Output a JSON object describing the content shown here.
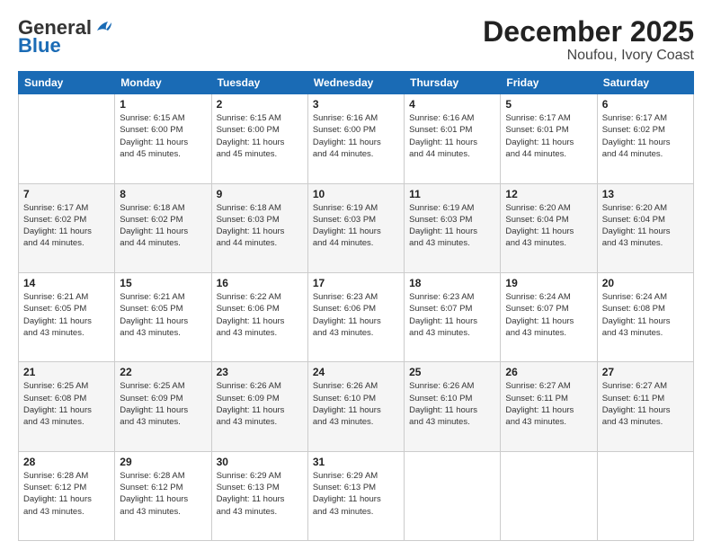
{
  "header": {
    "logo_general": "General",
    "logo_blue": "Blue",
    "title": "December 2025",
    "subtitle": "Noufou, Ivory Coast"
  },
  "weekdays": [
    "Sunday",
    "Monday",
    "Tuesday",
    "Wednesday",
    "Thursday",
    "Friday",
    "Saturday"
  ],
  "weeks": [
    [
      {
        "num": "",
        "info": ""
      },
      {
        "num": "1",
        "info": "Sunrise: 6:15 AM\nSunset: 6:00 PM\nDaylight: 11 hours\nand 45 minutes."
      },
      {
        "num": "2",
        "info": "Sunrise: 6:15 AM\nSunset: 6:00 PM\nDaylight: 11 hours\nand 45 minutes."
      },
      {
        "num": "3",
        "info": "Sunrise: 6:16 AM\nSunset: 6:00 PM\nDaylight: 11 hours\nand 44 minutes."
      },
      {
        "num": "4",
        "info": "Sunrise: 6:16 AM\nSunset: 6:01 PM\nDaylight: 11 hours\nand 44 minutes."
      },
      {
        "num": "5",
        "info": "Sunrise: 6:17 AM\nSunset: 6:01 PM\nDaylight: 11 hours\nand 44 minutes."
      },
      {
        "num": "6",
        "info": "Sunrise: 6:17 AM\nSunset: 6:02 PM\nDaylight: 11 hours\nand 44 minutes."
      }
    ],
    [
      {
        "num": "7",
        "info": "Sunrise: 6:17 AM\nSunset: 6:02 PM\nDaylight: 11 hours\nand 44 minutes."
      },
      {
        "num": "8",
        "info": "Sunrise: 6:18 AM\nSunset: 6:02 PM\nDaylight: 11 hours\nand 44 minutes."
      },
      {
        "num": "9",
        "info": "Sunrise: 6:18 AM\nSunset: 6:03 PM\nDaylight: 11 hours\nand 44 minutes."
      },
      {
        "num": "10",
        "info": "Sunrise: 6:19 AM\nSunset: 6:03 PM\nDaylight: 11 hours\nand 44 minutes."
      },
      {
        "num": "11",
        "info": "Sunrise: 6:19 AM\nSunset: 6:03 PM\nDaylight: 11 hours\nand 43 minutes."
      },
      {
        "num": "12",
        "info": "Sunrise: 6:20 AM\nSunset: 6:04 PM\nDaylight: 11 hours\nand 43 minutes."
      },
      {
        "num": "13",
        "info": "Sunrise: 6:20 AM\nSunset: 6:04 PM\nDaylight: 11 hours\nand 43 minutes."
      }
    ],
    [
      {
        "num": "14",
        "info": "Sunrise: 6:21 AM\nSunset: 6:05 PM\nDaylight: 11 hours\nand 43 minutes."
      },
      {
        "num": "15",
        "info": "Sunrise: 6:21 AM\nSunset: 6:05 PM\nDaylight: 11 hours\nand 43 minutes."
      },
      {
        "num": "16",
        "info": "Sunrise: 6:22 AM\nSunset: 6:06 PM\nDaylight: 11 hours\nand 43 minutes."
      },
      {
        "num": "17",
        "info": "Sunrise: 6:23 AM\nSunset: 6:06 PM\nDaylight: 11 hours\nand 43 minutes."
      },
      {
        "num": "18",
        "info": "Sunrise: 6:23 AM\nSunset: 6:07 PM\nDaylight: 11 hours\nand 43 minutes."
      },
      {
        "num": "19",
        "info": "Sunrise: 6:24 AM\nSunset: 6:07 PM\nDaylight: 11 hours\nand 43 minutes."
      },
      {
        "num": "20",
        "info": "Sunrise: 6:24 AM\nSunset: 6:08 PM\nDaylight: 11 hours\nand 43 minutes."
      }
    ],
    [
      {
        "num": "21",
        "info": "Sunrise: 6:25 AM\nSunset: 6:08 PM\nDaylight: 11 hours\nand 43 minutes."
      },
      {
        "num": "22",
        "info": "Sunrise: 6:25 AM\nSunset: 6:09 PM\nDaylight: 11 hours\nand 43 minutes."
      },
      {
        "num": "23",
        "info": "Sunrise: 6:26 AM\nSunset: 6:09 PM\nDaylight: 11 hours\nand 43 minutes."
      },
      {
        "num": "24",
        "info": "Sunrise: 6:26 AM\nSunset: 6:10 PM\nDaylight: 11 hours\nand 43 minutes."
      },
      {
        "num": "25",
        "info": "Sunrise: 6:26 AM\nSunset: 6:10 PM\nDaylight: 11 hours\nand 43 minutes."
      },
      {
        "num": "26",
        "info": "Sunrise: 6:27 AM\nSunset: 6:11 PM\nDaylight: 11 hours\nand 43 minutes."
      },
      {
        "num": "27",
        "info": "Sunrise: 6:27 AM\nSunset: 6:11 PM\nDaylight: 11 hours\nand 43 minutes."
      }
    ],
    [
      {
        "num": "28",
        "info": "Sunrise: 6:28 AM\nSunset: 6:12 PM\nDaylight: 11 hours\nand 43 minutes."
      },
      {
        "num": "29",
        "info": "Sunrise: 6:28 AM\nSunset: 6:12 PM\nDaylight: 11 hours\nand 43 minutes."
      },
      {
        "num": "30",
        "info": "Sunrise: 6:29 AM\nSunset: 6:13 PM\nDaylight: 11 hours\nand 43 minutes."
      },
      {
        "num": "31",
        "info": "Sunrise: 6:29 AM\nSunset: 6:13 PM\nDaylight: 11 hours\nand 43 minutes."
      },
      {
        "num": "",
        "info": ""
      },
      {
        "num": "",
        "info": ""
      },
      {
        "num": "",
        "info": ""
      }
    ]
  ]
}
